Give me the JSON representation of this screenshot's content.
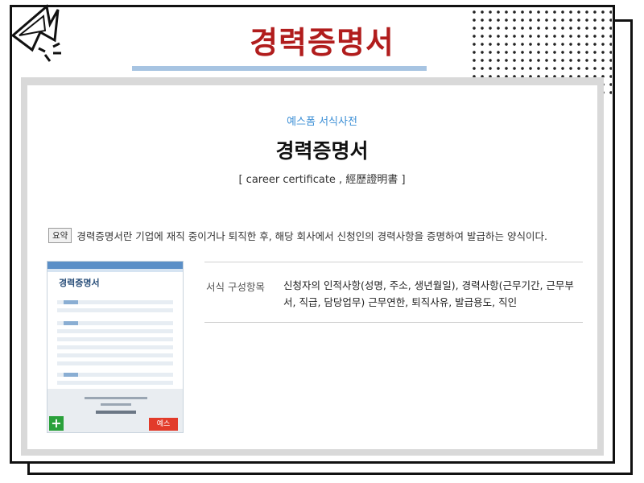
{
  "header": {
    "title": "경력증명서"
  },
  "document": {
    "source": "예스폼 서식사전",
    "title": "경력증명서",
    "subtitle": "[ career certificate , 經歷證明書 ]",
    "summary_tag": "요약",
    "summary_text": "경력증명서란 기업에 재직 중이거나 퇴직한 후, 해당 회사에서 신청인의 경력사항을 증명하여 발급하는 양식이다.",
    "composition_label": "서식 구성항목",
    "composition_value": "신청자의 인적사항(성명, 주소, 생년월일), 경력사항(근무기간, 근무부서, 직급, 담당업무) 근무연한, 퇴직사유, 발급용도, 직인"
  },
  "thumbnail": {
    "title": "경력증명서",
    "plus_symbol": "+",
    "badge_text": "예스"
  },
  "colors": {
    "title_red": "#b11d1d",
    "source_blue": "#3c8fd6",
    "accent_bar": "#a7c4e2"
  }
}
